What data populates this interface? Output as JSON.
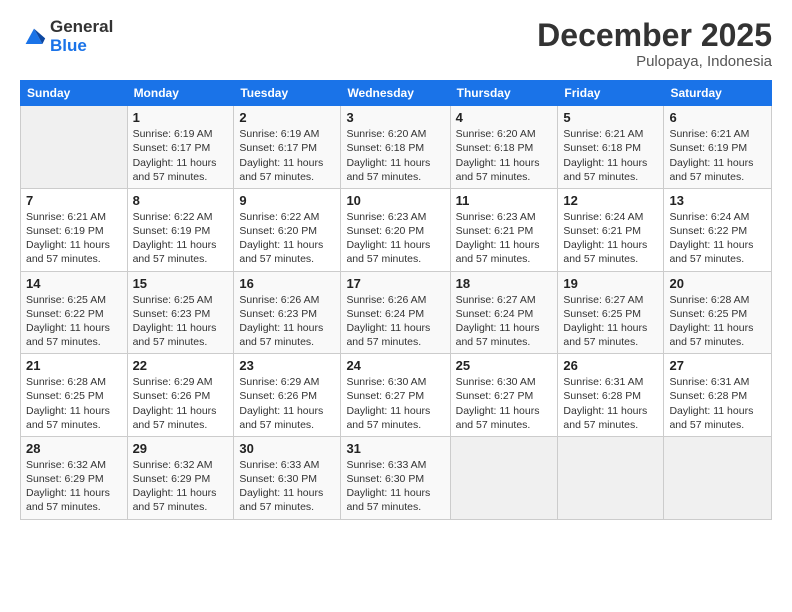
{
  "logo": {
    "general": "General",
    "blue": "Blue"
  },
  "header": {
    "title": "December 2025",
    "subtitle": "Pulopaya, Indonesia"
  },
  "weekdays": [
    "Sunday",
    "Monday",
    "Tuesday",
    "Wednesday",
    "Thursday",
    "Friday",
    "Saturday"
  ],
  "weeks": [
    [
      {
        "day": "",
        "sunrise": "",
        "sunset": "",
        "daylight": ""
      },
      {
        "day": "1",
        "sunrise": "Sunrise: 6:19 AM",
        "sunset": "Sunset: 6:17 PM",
        "daylight": "Daylight: 11 hours and 57 minutes."
      },
      {
        "day": "2",
        "sunrise": "Sunrise: 6:19 AM",
        "sunset": "Sunset: 6:17 PM",
        "daylight": "Daylight: 11 hours and 57 minutes."
      },
      {
        "day": "3",
        "sunrise": "Sunrise: 6:20 AM",
        "sunset": "Sunset: 6:18 PM",
        "daylight": "Daylight: 11 hours and 57 minutes."
      },
      {
        "day": "4",
        "sunrise": "Sunrise: 6:20 AM",
        "sunset": "Sunset: 6:18 PM",
        "daylight": "Daylight: 11 hours and 57 minutes."
      },
      {
        "day": "5",
        "sunrise": "Sunrise: 6:21 AM",
        "sunset": "Sunset: 6:18 PM",
        "daylight": "Daylight: 11 hours and 57 minutes."
      },
      {
        "day": "6",
        "sunrise": "Sunrise: 6:21 AM",
        "sunset": "Sunset: 6:19 PM",
        "daylight": "Daylight: 11 hours and 57 minutes."
      }
    ],
    [
      {
        "day": "7",
        "sunrise": "Sunrise: 6:21 AM",
        "sunset": "Sunset: 6:19 PM",
        "daylight": "Daylight: 11 hours and 57 minutes."
      },
      {
        "day": "8",
        "sunrise": "Sunrise: 6:22 AM",
        "sunset": "Sunset: 6:19 PM",
        "daylight": "Daylight: 11 hours and 57 minutes."
      },
      {
        "day": "9",
        "sunrise": "Sunrise: 6:22 AM",
        "sunset": "Sunset: 6:20 PM",
        "daylight": "Daylight: 11 hours and 57 minutes."
      },
      {
        "day": "10",
        "sunrise": "Sunrise: 6:23 AM",
        "sunset": "Sunset: 6:20 PM",
        "daylight": "Daylight: 11 hours and 57 minutes."
      },
      {
        "day": "11",
        "sunrise": "Sunrise: 6:23 AM",
        "sunset": "Sunset: 6:21 PM",
        "daylight": "Daylight: 11 hours and 57 minutes."
      },
      {
        "day": "12",
        "sunrise": "Sunrise: 6:24 AM",
        "sunset": "Sunset: 6:21 PM",
        "daylight": "Daylight: 11 hours and 57 minutes."
      },
      {
        "day": "13",
        "sunrise": "Sunrise: 6:24 AM",
        "sunset": "Sunset: 6:22 PM",
        "daylight": "Daylight: 11 hours and 57 minutes."
      }
    ],
    [
      {
        "day": "14",
        "sunrise": "Sunrise: 6:25 AM",
        "sunset": "Sunset: 6:22 PM",
        "daylight": "Daylight: 11 hours and 57 minutes."
      },
      {
        "day": "15",
        "sunrise": "Sunrise: 6:25 AM",
        "sunset": "Sunset: 6:23 PM",
        "daylight": "Daylight: 11 hours and 57 minutes."
      },
      {
        "day": "16",
        "sunrise": "Sunrise: 6:26 AM",
        "sunset": "Sunset: 6:23 PM",
        "daylight": "Daylight: 11 hours and 57 minutes."
      },
      {
        "day": "17",
        "sunrise": "Sunrise: 6:26 AM",
        "sunset": "Sunset: 6:24 PM",
        "daylight": "Daylight: 11 hours and 57 minutes."
      },
      {
        "day": "18",
        "sunrise": "Sunrise: 6:27 AM",
        "sunset": "Sunset: 6:24 PM",
        "daylight": "Daylight: 11 hours and 57 minutes."
      },
      {
        "day": "19",
        "sunrise": "Sunrise: 6:27 AM",
        "sunset": "Sunset: 6:25 PM",
        "daylight": "Daylight: 11 hours and 57 minutes."
      },
      {
        "day": "20",
        "sunrise": "Sunrise: 6:28 AM",
        "sunset": "Sunset: 6:25 PM",
        "daylight": "Daylight: 11 hours and 57 minutes."
      }
    ],
    [
      {
        "day": "21",
        "sunrise": "Sunrise: 6:28 AM",
        "sunset": "Sunset: 6:25 PM",
        "daylight": "Daylight: 11 hours and 57 minutes."
      },
      {
        "day": "22",
        "sunrise": "Sunrise: 6:29 AM",
        "sunset": "Sunset: 6:26 PM",
        "daylight": "Daylight: 11 hours and 57 minutes."
      },
      {
        "day": "23",
        "sunrise": "Sunrise: 6:29 AM",
        "sunset": "Sunset: 6:26 PM",
        "daylight": "Daylight: 11 hours and 57 minutes."
      },
      {
        "day": "24",
        "sunrise": "Sunrise: 6:30 AM",
        "sunset": "Sunset: 6:27 PM",
        "daylight": "Daylight: 11 hours and 57 minutes."
      },
      {
        "day": "25",
        "sunrise": "Sunrise: 6:30 AM",
        "sunset": "Sunset: 6:27 PM",
        "daylight": "Daylight: 11 hours and 57 minutes."
      },
      {
        "day": "26",
        "sunrise": "Sunrise: 6:31 AM",
        "sunset": "Sunset: 6:28 PM",
        "daylight": "Daylight: 11 hours and 57 minutes."
      },
      {
        "day": "27",
        "sunrise": "Sunrise: 6:31 AM",
        "sunset": "Sunset: 6:28 PM",
        "daylight": "Daylight: 11 hours and 57 minutes."
      }
    ],
    [
      {
        "day": "28",
        "sunrise": "Sunrise: 6:32 AM",
        "sunset": "Sunset: 6:29 PM",
        "daylight": "Daylight: 11 hours and 57 minutes."
      },
      {
        "day": "29",
        "sunrise": "Sunrise: 6:32 AM",
        "sunset": "Sunset: 6:29 PM",
        "daylight": "Daylight: 11 hours and 57 minutes."
      },
      {
        "day": "30",
        "sunrise": "Sunrise: 6:33 AM",
        "sunset": "Sunset: 6:30 PM",
        "daylight": "Daylight: 11 hours and 57 minutes."
      },
      {
        "day": "31",
        "sunrise": "Sunrise: 6:33 AM",
        "sunset": "Sunset: 6:30 PM",
        "daylight": "Daylight: 11 hours and 57 minutes."
      },
      {
        "day": "",
        "sunrise": "",
        "sunset": "",
        "daylight": ""
      },
      {
        "day": "",
        "sunrise": "",
        "sunset": "",
        "daylight": ""
      },
      {
        "day": "",
        "sunrise": "",
        "sunset": "",
        "daylight": ""
      }
    ]
  ]
}
